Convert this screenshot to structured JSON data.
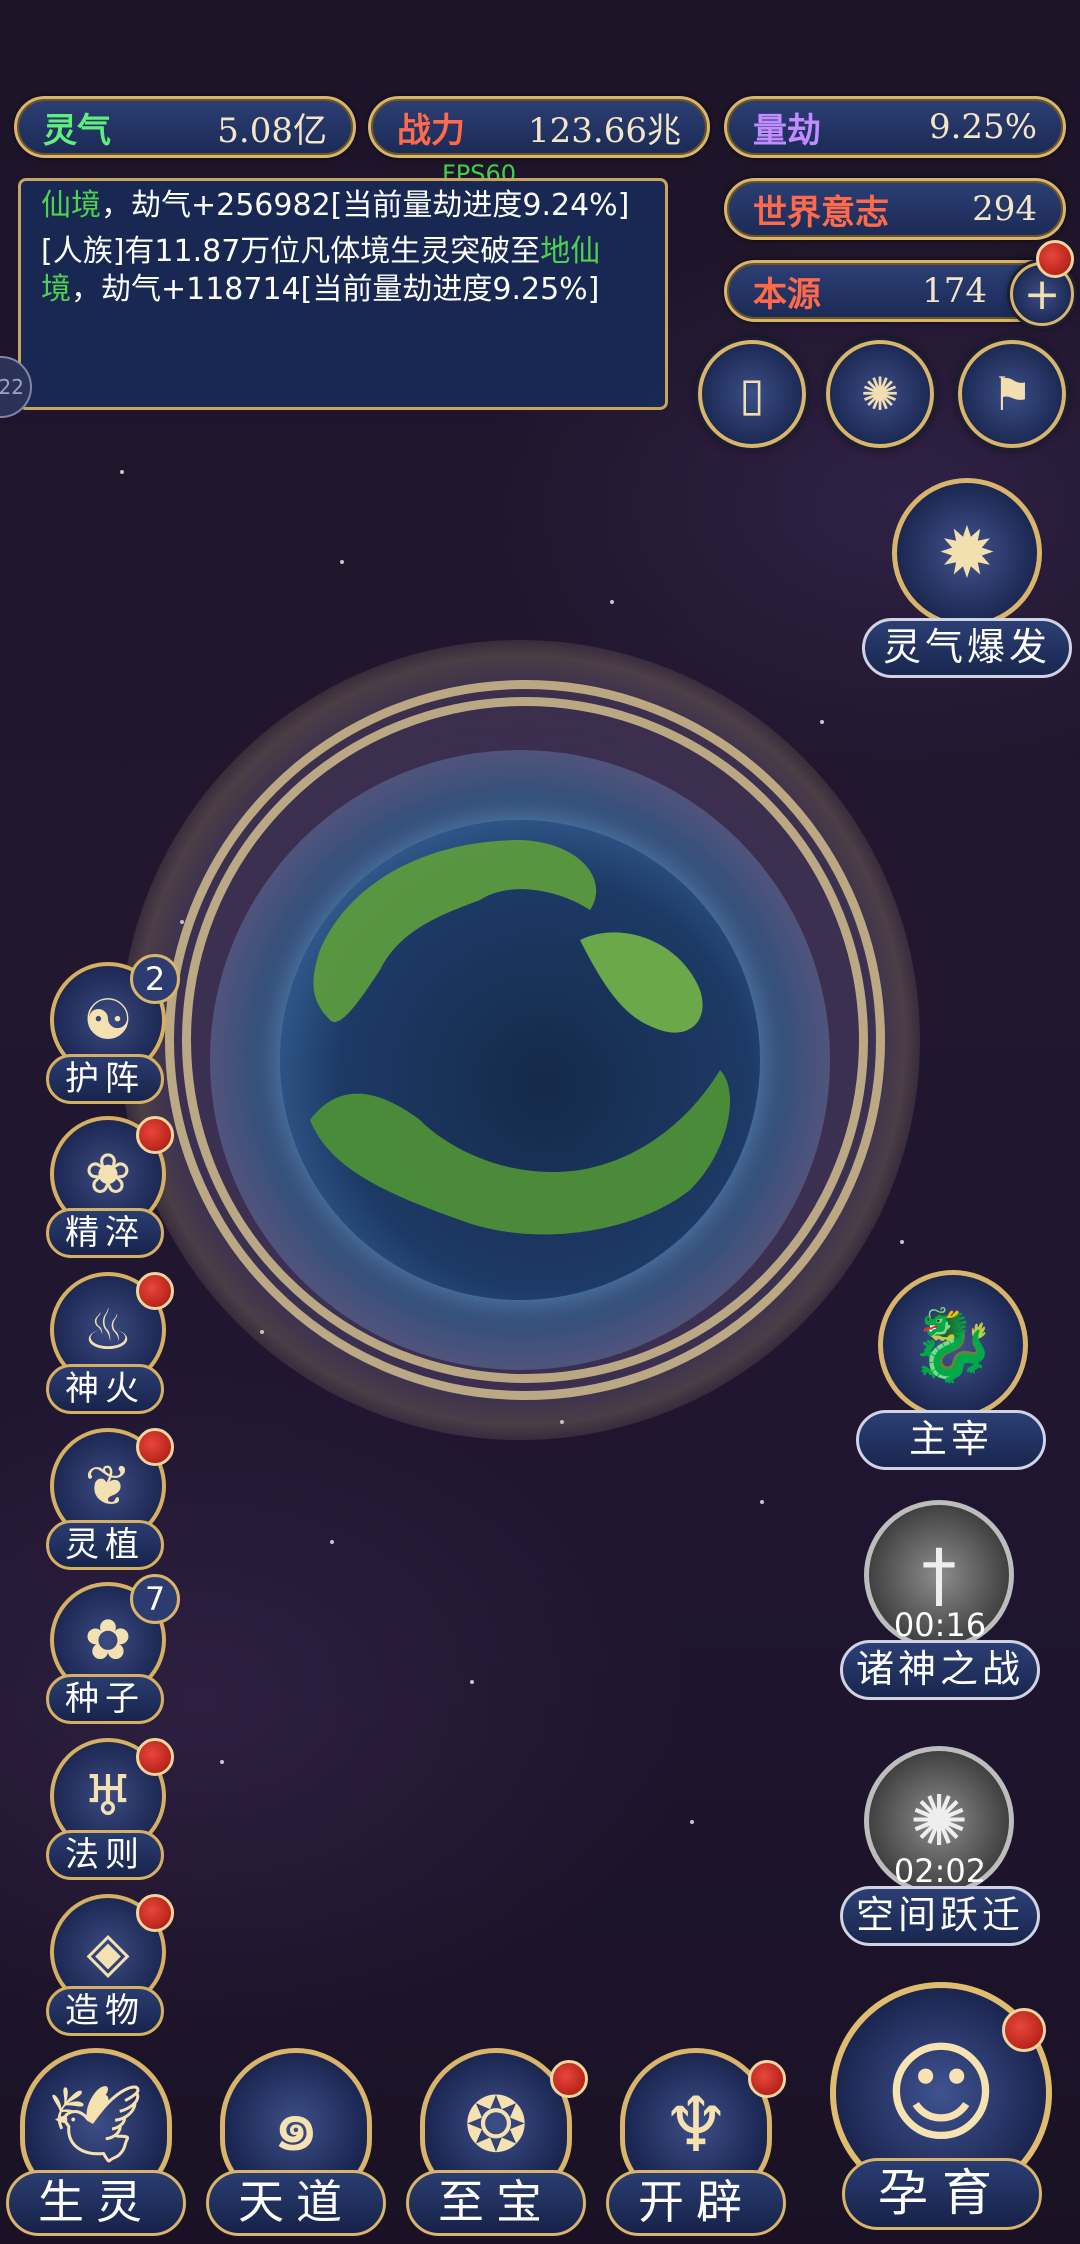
{
  "stats": {
    "lingqi": {
      "label": "灵气",
      "value": "5.08亿",
      "color": "#5ef07a"
    },
    "zhanli": {
      "label": "战力",
      "value": "123.66兆",
      "color": "#ff6a4a"
    },
    "liangjie": {
      "label": "量劫",
      "value": "9.25%",
      "color": "#c08cff"
    },
    "shijie": {
      "label": "世界意志",
      "value": "294",
      "color": "#ff6a4a"
    },
    "benyuan": {
      "label": "本源",
      "value": "174",
      "color": "#ff6a4a"
    }
  },
  "fps": "FPS60",
  "log": {
    "entry1_green": "仙境",
    "entry1_rest": "，劫气+256982[当前量劫进度9.24%]",
    "entry2_a": "[人族]有11.87万位凡体境生灵突破至",
    "entry2_green": "地仙境",
    "entry2_rest": "，劫气+118714[当前量劫进度9.25%]"
  },
  "top_buttons": [
    "card-icon",
    "vortex-icon",
    "flag-icon"
  ],
  "burst": {
    "label": "灵气爆发"
  },
  "left_menu": [
    {
      "label": "护阵",
      "badge": "2",
      "dot": false
    },
    {
      "label": "精淬",
      "badge": "",
      "dot": true
    },
    {
      "label": "神火",
      "badge": "",
      "dot": true
    },
    {
      "label": "灵植",
      "badge": "",
      "dot": true
    },
    {
      "label": "种子",
      "badge": "7",
      "dot": false
    },
    {
      "label": "法则",
      "badge": "",
      "dot": true
    },
    {
      "label": "造物",
      "badge": "",
      "dot": true
    }
  ],
  "right_features": {
    "zhuzai": {
      "label": "主宰"
    },
    "zhushen": {
      "label": "诸神之战",
      "timer": "00:16"
    },
    "kongjian": {
      "label": "空间跃迁",
      "timer": "02:02"
    }
  },
  "bottom_nav": [
    {
      "label": "生灵",
      "dot": false
    },
    {
      "label": "天道",
      "dot": false
    },
    {
      "label": "至宝",
      "dot": true
    },
    {
      "label": "开辟",
      "dot": true
    },
    {
      "label": "孕育",
      "dot": true
    }
  ],
  "side_tab": "22"
}
